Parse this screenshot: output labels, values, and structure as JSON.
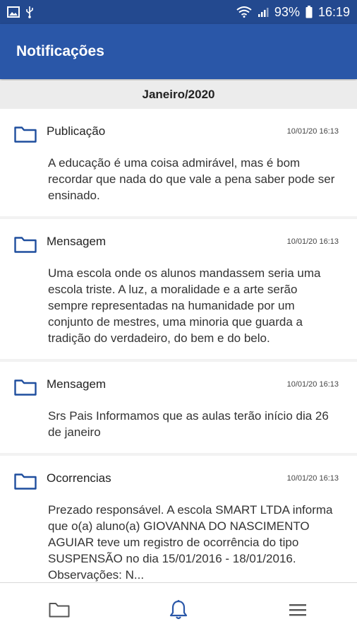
{
  "status_bar": {
    "battery": "93%",
    "time": "16:19"
  },
  "app_bar": {
    "title": "Notificações"
  },
  "month_header": "Janeiro/2020",
  "notifications": [
    {
      "title": "Publicação",
      "date": "10/01/20 16:13",
      "body": "A educação é uma coisa admirável, mas é bom recordar que nada do que vale a pena saber pode ser ensinado."
    },
    {
      "title": "Mensagem",
      "date": "10/01/20 16:13",
      "body": "Uma escola onde os alunos mandassem seria uma escola triste. A luz, a moralidade e a arte serão sempre representadas na humanidade por um conjunto de mestres, uma minoria que guarda a tradição do verdadeiro, do bem e do belo."
    },
    {
      "title": "Mensagem",
      "date": "10/01/20 16:13",
      "body": "Srs Pais Informamos que as aulas terão início dia 26 de janeiro"
    },
    {
      "title": "Ocorrencias",
      "date": "10/01/20 16:13",
      "body": "Prezado responsável. A escola SMART LTDA informa que o(a) aluno(a) GIOVANNA DO NASCIMENTO AGUIAR teve um registro de ocorrência do tipo SUSPENSÃO no dia 15/01/2016 - 18/01/2016. Observações: N..."
    }
  ],
  "bottom_nav": [
    {
      "icon": "folder-icon"
    },
    {
      "icon": "bell-icon"
    },
    {
      "icon": "menu-icon"
    }
  ],
  "colors": {
    "status_bar": "#23498f",
    "app_bar": "#2a57a8",
    "icon_blue": "#1f4e9e"
  }
}
